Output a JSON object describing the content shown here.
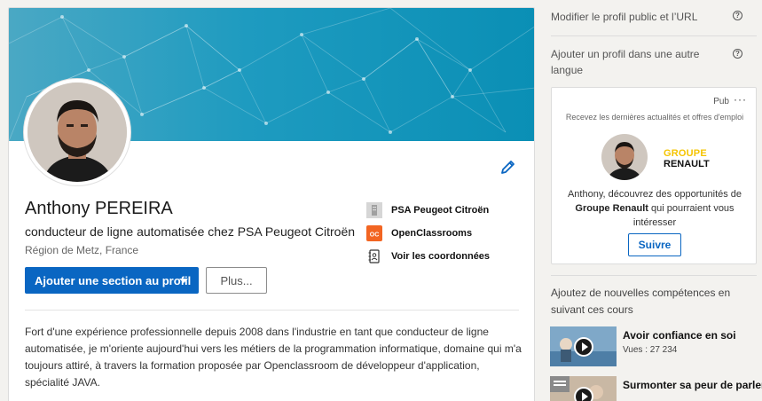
{
  "profile": {
    "name": "Anthony PEREIRA",
    "headline": "conducteur de ligne automatisée chez PSA Peugeot Citroën",
    "location": "Région de Metz, France",
    "primary_button": "Ajouter une section au profil",
    "secondary_button": "Plus...",
    "side_links": [
      {
        "label": "PSA Peugeot Citroën",
        "icon": "company-icon"
      },
      {
        "label": "OpenClassrooms",
        "icon": "openclassrooms-logo-icon"
      },
      {
        "label": "Voir les coordonnées",
        "icon": "contact-book-icon"
      }
    ],
    "summary": "Fort d'une expérience professionnelle depuis 2008 dans l'industrie en tant que conducteur de ligne automatisée, je m'oriente aujourd'hui vers les métiers de la programmation informatique, domaine qui m'a toujours attiré, à travers la formation proposée par Openclassroom de développeur d'application, spécialité JAVA."
  },
  "sidebar": {
    "edit_public_profile": "Modifier le profil public et l’URL",
    "add_language_profile": "Ajouter un profil dans une autre langue",
    "help_icon": "?",
    "ad": {
      "label": "Pub",
      "menu": "···",
      "tagline": "Recevez les dernières actualités et offres d'emploi",
      "logo_line1": "GROUPE",
      "logo_line2": "RENAULT",
      "text_before": "Anthony, découvrez des opportunités de ",
      "text_bold": "Groupe Renault",
      "text_after": " qui pourraient vous intéresser",
      "button": "Suivre"
    },
    "courses_title": "Ajoutez de nouvelles compétences en suivant ces cours",
    "courses": [
      {
        "title": "Avoir confiance en soi",
        "views": "Vues : 27 234"
      },
      {
        "title": "Surmonter sa peur de parler",
        "views": ""
      }
    ]
  },
  "colors": {
    "brand_blue": "#0a66c2",
    "banner": "#1e9bc0",
    "renault_yellow": "#f5c400",
    "openclassrooms_orange": "#f26522"
  }
}
